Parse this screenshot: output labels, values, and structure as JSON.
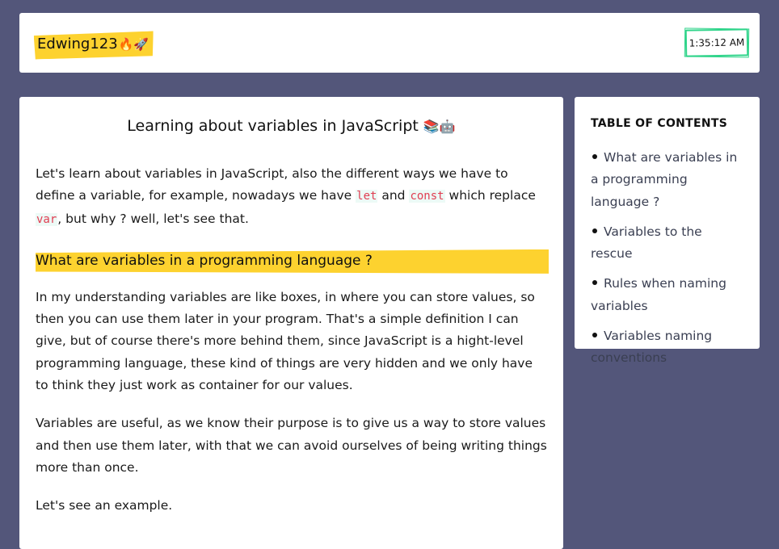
{
  "header": {
    "logo_text": "Edwing123",
    "logo_emoji": "🔥🚀",
    "clock": "1:35:12 AM"
  },
  "article": {
    "title": "Learning about variables in JavaScript",
    "title_emoji": "📚🤖",
    "intro": {
      "part1": "Let's learn about variables in JavaScript, also the different ways we have to define a variable, for example, nowadays we have ",
      "code1": "let",
      "part2": " and ",
      "code2": "const",
      "part3": " which replace ",
      "code3": "var",
      "part4": ", but why ? well, let's see that."
    },
    "section_heading": "What are variables in a programming language ?",
    "paragraph2": "In my understanding variables are like boxes, in where you can store values, so then you can use them later in your program. That's a simple definition I can give, but of course there's more behind them, since JavaScript is a hight-level programming language, these kind of things are very hidden and we only have to think they just work as container for our values.",
    "paragraph3": "Variables are useful, as we know their purpose is to give us a way to store values and then use them later, with that we can avoid ourselves of being writing things more than once.",
    "paragraph4": "Let's see an example."
  },
  "toc": {
    "title": "TABLE OF CONTENTS",
    "items": [
      {
        "label": "What are variables in a programming language ?"
      },
      {
        "label": "Variables to the rescue"
      },
      {
        "label": "Rules when naming variables"
      },
      {
        "label": "Variables naming conventions"
      }
    ]
  },
  "colors": {
    "background": "#53567a",
    "highlight": "#fdd22f",
    "clock_border": "#2fd48a",
    "code_text": "#e03e52"
  }
}
